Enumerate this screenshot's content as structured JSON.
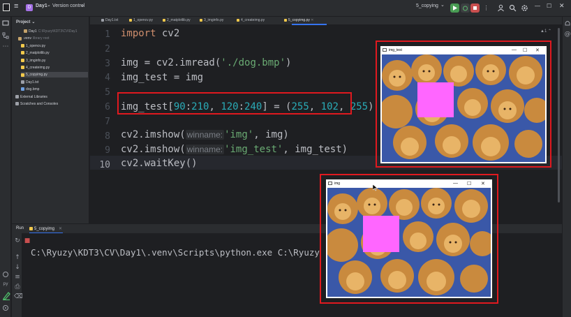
{
  "titlebar": {
    "project_badge": "D",
    "project_name": "Day1",
    "vcs": "Version control",
    "run_config": "5_copying",
    "chevron": "⌄",
    "menu": "≡"
  },
  "project_panel": {
    "header": "Project",
    "items": [
      {
        "label": "Day1",
        "path": "C:\\Ryuzy\\KDT3\\CV\\Day1",
        "kind": "folder"
      },
      {
        "label": ".venv",
        "extra": "library root",
        "kind": "folder"
      },
      {
        "label": "1_opencv.py",
        "kind": "py"
      },
      {
        "label": "2_matplotlib.py",
        "kind": "py"
      },
      {
        "label": "3_imginfo.py",
        "kind": "py"
      },
      {
        "label": "4_createimg.py",
        "kind": "py"
      },
      {
        "label": "5_copyimg.py",
        "kind": "py"
      },
      {
        "label": "Day1.txt",
        "kind": "txt"
      },
      {
        "label": "dog.bmp",
        "kind": "img"
      },
      {
        "label": "External Libraries",
        "kind": "lib"
      },
      {
        "label": "Scratches and Consoles",
        "kind": "scratch"
      }
    ]
  },
  "tabs": [
    {
      "label": "Day1.txt",
      "active": false
    },
    {
      "label": "1_opencv.py",
      "active": false
    },
    {
      "label": "2_matplotlib.py",
      "active": false
    },
    {
      "label": "3_imginfo.py",
      "active": false
    },
    {
      "label": "4_createimg.py",
      "active": false
    },
    {
      "label": "5_copyimg.py",
      "active": true
    }
  ],
  "editor": {
    "line_numbers": [
      "1",
      "2",
      "3",
      "4",
      "5",
      "6",
      "7",
      "8",
      "9",
      "10"
    ],
    "current_line": 10,
    "warning_count": "1",
    "lines": {
      "l1_kw": "import",
      "l1_rest": " cv2",
      "l3_a": "img = cv2.imread(",
      "l3_str": "'./dog.bmp'",
      "l3_b": ")",
      "l4": "img_test = img",
      "l6_a": "img_test[",
      "l6_n1": "90",
      "l6_c": ":",
      "l6_n2": "210",
      "l6_d": ", ",
      "l6_n3": "120",
      "l6_e": ":",
      "l6_n4": "240",
      "l6_f": "] = (",
      "l6_n5": "255",
      "l6_g": ", ",
      "l6_n6": "102",
      "l6_h": ", ",
      "l6_n7": "255",
      "l6_i": ")",
      "l8_a": "cv2.imshow(",
      "l8_hint": "winname:",
      "l8_str": "'img'",
      "l8_b": ", img)",
      "l9_a": "cv2.imshow(",
      "l9_hint": "winname:",
      "l9_str": "'img_test'",
      "l9_b": ", img_test)",
      "l10": "cv2.waitKey()"
    }
  },
  "run_panel": {
    "tab_label": "Run",
    "config_tab": "5_copyimg",
    "output": "C:\\Ryuzy\\KDT3\\CV\\Day1\\.venv\\Scripts\\python.exe C:\\Ryuzy"
  },
  "windows": [
    {
      "title": "img_test",
      "minimize": "—",
      "maximize": "☐",
      "close": "✕"
    },
    {
      "title": "img",
      "minimize": "—",
      "maximize": "☐",
      "close": "✕"
    }
  ],
  "colors": {
    "highlight_box": "#e0191f",
    "fill_rgb_bgr": "#ff66ff",
    "accent": "#3574f0"
  },
  "icons": [
    "menu-icon",
    "folder-icon",
    "structure-icon",
    "more-icon",
    "run-icon",
    "debug-icon",
    "stop-icon",
    "profile-icon",
    "search-icon",
    "settings-icon",
    "notifications-icon",
    "rerun-icon",
    "terminal-icon",
    "git-icon"
  ]
}
